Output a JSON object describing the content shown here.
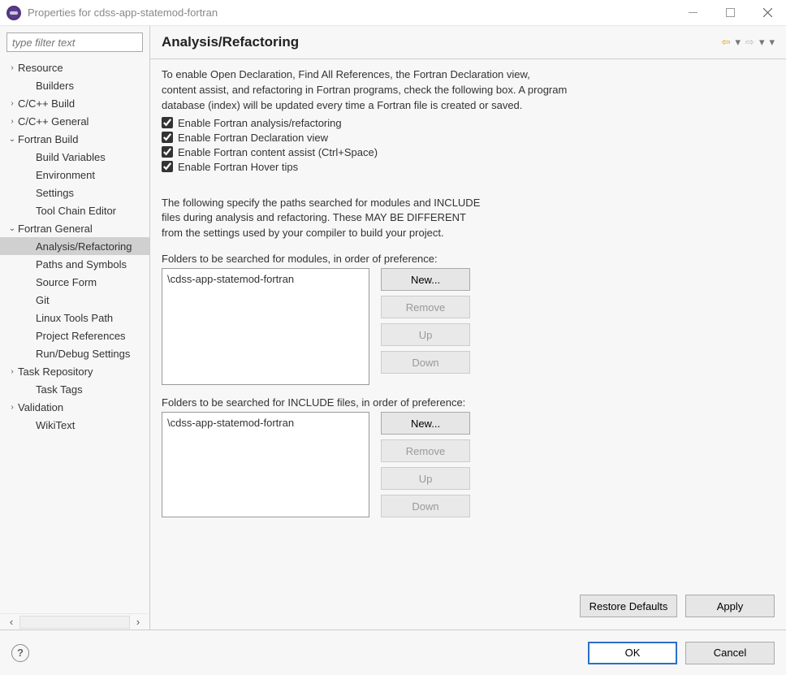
{
  "window": {
    "title": "Properties for cdss-app-statemod-fortran"
  },
  "sidebar": {
    "filter_placeholder": "type filter text",
    "items": [
      {
        "label": "Resource",
        "level": 1,
        "tw": ">"
      },
      {
        "label": "Builders",
        "level": 2,
        "tw": ""
      },
      {
        "label": "C/C++ Build",
        "level": 1,
        "tw": ">"
      },
      {
        "label": "C/C++ General",
        "level": 1,
        "tw": ">"
      },
      {
        "label": "Fortran Build",
        "level": 1,
        "tw": "v"
      },
      {
        "label": "Build Variables",
        "level": 2,
        "tw": ""
      },
      {
        "label": "Environment",
        "level": 2,
        "tw": ""
      },
      {
        "label": "Settings",
        "level": 2,
        "tw": ""
      },
      {
        "label": "Tool Chain Editor",
        "level": 2,
        "tw": ""
      },
      {
        "label": "Fortran General",
        "level": 1,
        "tw": "v"
      },
      {
        "label": "Analysis/Refactoring",
        "level": 2,
        "tw": "",
        "selected": true
      },
      {
        "label": "Paths and Symbols",
        "level": 2,
        "tw": ""
      },
      {
        "label": "Source Form",
        "level": 2,
        "tw": ""
      },
      {
        "label": "Git",
        "level": 2,
        "tw": ""
      },
      {
        "label": "Linux Tools Path",
        "level": 2,
        "tw": ""
      },
      {
        "label": "Project References",
        "level": 2,
        "tw": ""
      },
      {
        "label": "Run/Debug Settings",
        "level": 2,
        "tw": ""
      },
      {
        "label": "Task Repository",
        "level": 1,
        "tw": ">"
      },
      {
        "label": "Task Tags",
        "level": 2,
        "tw": ""
      },
      {
        "label": "Validation",
        "level": 1,
        "tw": ">"
      },
      {
        "label": "WikiText",
        "level": 2,
        "tw": ""
      }
    ]
  },
  "page": {
    "heading": "Analysis/Refactoring",
    "intro": "To enable Open Declaration, Find All References, the Fortran Declaration view, content assist, and refactoring in Fortran programs, check the following box.  A program database (index) will be updated every time a Fortran file is created or saved.",
    "checks": [
      "Enable Fortran analysis/refactoring",
      "Enable Fortran Declaration view",
      "Enable Fortran content assist (Ctrl+Space)",
      "Enable Fortran Hover tips"
    ],
    "paths_intro": "The following specify the paths searched for modules and INCLUDE files during analysis and refactoring. These MAY BE DIFFERENT from the settings used by your compiler to build your project.",
    "modules_label": "Folders to be searched for modules, in order of preference:",
    "modules_entries": [
      "\\cdss-app-statemod-fortran"
    ],
    "include_label": "Folders to be searched for INCLUDE files, in order of preference:",
    "include_entries": [
      "\\cdss-app-statemod-fortran"
    ],
    "buttons": {
      "new": "New...",
      "remove": "Remove",
      "up": "Up",
      "down": "Down"
    },
    "restore_defaults": "Restore Defaults",
    "apply": "Apply"
  },
  "footer": {
    "ok": "OK",
    "cancel": "Cancel"
  }
}
